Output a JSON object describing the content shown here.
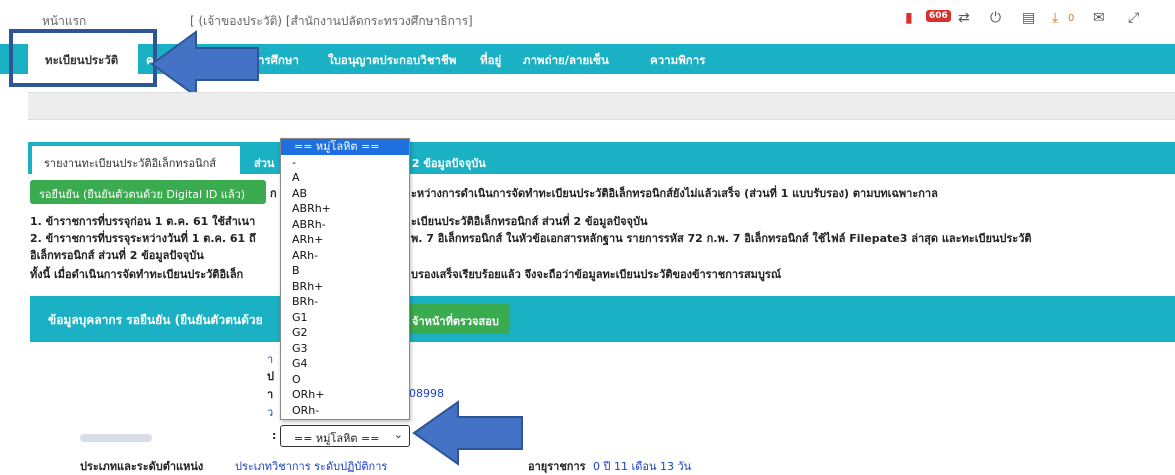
{
  "header": {
    "home": "หน้าแรก",
    "org": "[ (เจ้าของประวัติ) [สำนักงานปลัดกระทรวงศึกษาธิการ]",
    "notification_count": "606",
    "download_count": "0"
  },
  "nav": {
    "tabs": [
      "ทะเบียนประวัติ",
      "ค",
      "ารศึกษา",
      "ใบอนุญาตประกอบวิชาชีพ",
      "ที่อยู่",
      "ภาพถ่าย/ลายเซ็น",
      "ความพิการ"
    ]
  },
  "section_tabs": {
    "active": "รายงานทะเบียนประวัติอิเล็กทรอนิกส์",
    "second_prefix": "ส่วน",
    "second_suffix": "ี่ 2 ข้อมูลปัจจุบัน"
  },
  "notice": {
    "status_button": "รอยืนยัน (ยืนยันตัวตนด้วย Digital ID แล้ว)",
    "line0_mid": "ก",
    "line0": "ะหว่างการดำเนินการจัดทำทะเบียนประวัติอิเล็กทรอนิกส์ยังไม่แล้วเสร็จ (ส่วนที่ 1 แบบรับรอง) ตามบทเฉพาะกาล",
    "line1a": "1. ข้าราชการที่บรรจุก่อน 1 ต.ค. 61 ใช้สำเนา",
    "line1b": "ะเบียนประวัติอิเล็กทรอนิกส์ ส่วนที่ 2 ข้อมูลปัจจุบัน",
    "line2a": "2. ข้าราชการที่บรรจุระหว่างวันที่ 1 ต.ค. 61 ถึ",
    "line2b": "พ. 7 อิเล็กทรอนิกส์ ในหัวข้อเอกสารหลักฐาน รายการรหัส 72 ก.พ. 7 อิเล็กทรอนิกส์ ใช้ไฟล์ Filepate3 ล่าสุด และทะเบียนประวัติ",
    "line3": "อิเล็กทรอนิกส์ ส่วนที่ 2 ข้อมูลปัจจุบัน",
    "line4a": "ทั้งนี้ เมื่อดำเนินการจัดทำทะเบียนประวัติอิเล็ก",
    "line4b": "บรองเสร็จเรียบร้อยแล้ว จึงจะถือว่าข้อมูลทะเบียนประวัติของข้าราชการสมบูรณ์"
  },
  "panel": {
    "title": "ข้อมูลบุคลากร รอยืนยัน (ยืนยันตัวตนด้วย",
    "verify_button": "จ้าหน้าที่ตรวจสอบ",
    "frag_a": "า",
    "frag_b": "ป",
    "frag_c": "า",
    "frag_id": "08998",
    "frag_d": "ว",
    "colon": ":",
    "position_label": "ประเภทและระดับตำแหน่ง",
    "position_value": "ประเภทวิชาการ ระดับปฏิบัติการ",
    "service_label": "อายุราชการ",
    "service_value": "0 ปี 11 เดือน 13 วัน"
  },
  "blood_group": {
    "selected": "== หมู่โลหิต ==",
    "options": [
      "== หมู่โลหิต ==",
      "-",
      "A",
      "AB",
      "ABRh+",
      "ABRh-",
      "ARh+",
      "ARh-",
      "B",
      "BRh+",
      "BRh-",
      "G1",
      "G2",
      "G3",
      "G4",
      "O",
      "ORh+",
      "ORh-"
    ]
  },
  "colors": {
    "teal": "#1bb1c4",
    "green": "#3bab4f",
    "highlight": "#1e6fe0",
    "annotation_blue": "#4472c4"
  }
}
